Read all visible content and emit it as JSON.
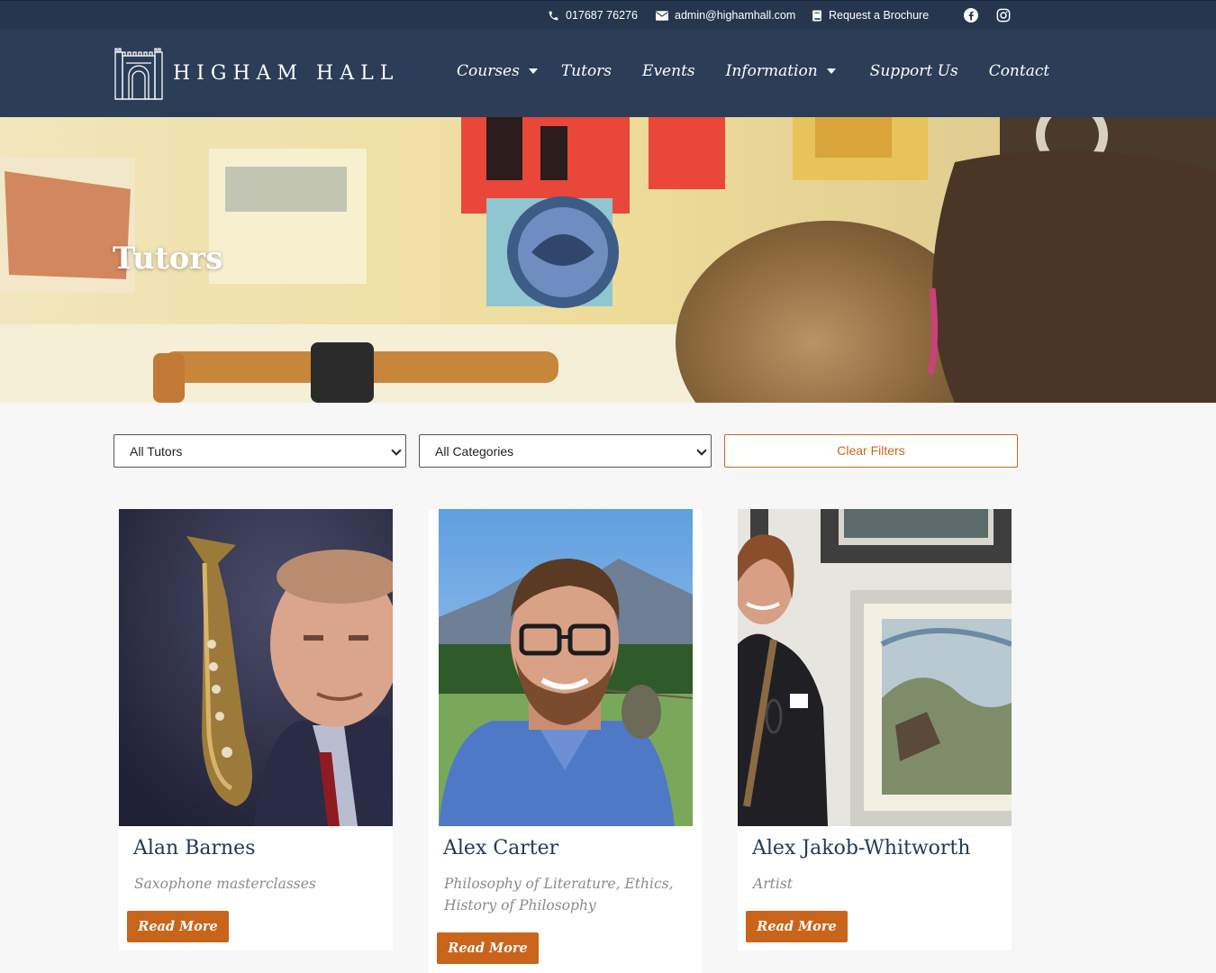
{
  "topbar": {
    "phone": "017687 76276",
    "email": "admin@highamhall.com",
    "brochure": "Request a Brochure",
    "icons": [
      "phone-icon",
      "envelope-icon",
      "book-icon",
      "facebook-icon",
      "instagram-icon"
    ]
  },
  "header": {
    "logo_text": "HIGHAM HALL",
    "nav": [
      {
        "label": "Courses",
        "dropdown": true
      },
      {
        "label": "Tutors",
        "dropdown": false
      },
      {
        "label": "Events",
        "dropdown": false
      },
      {
        "label": "Information",
        "dropdown": true
      },
      {
        "label": "Support Us",
        "dropdown": false
      },
      {
        "label": "Contact",
        "dropdown": false
      }
    ]
  },
  "hero": {
    "title": "Tutors"
  },
  "filters": {
    "tutor_select": "All Tutors",
    "category_select": "All Categories",
    "clear_label": "Clear Filters"
  },
  "tutors": [
    {
      "name": "Alan Barnes",
      "subtitle": "Saxophone masterclasses",
      "button": "Read More"
    },
    {
      "name": "Alex Carter",
      "subtitle": "Philosophy of Literature, Ethics, History of Philosophy",
      "button": "Read More"
    },
    {
      "name": "Alex Jakob-Whitworth",
      "subtitle": "Artist",
      "button": "Read More"
    }
  ],
  "colors": {
    "navy": "#2b3d57",
    "accent": "#c8651b",
    "title": "#25385a"
  }
}
